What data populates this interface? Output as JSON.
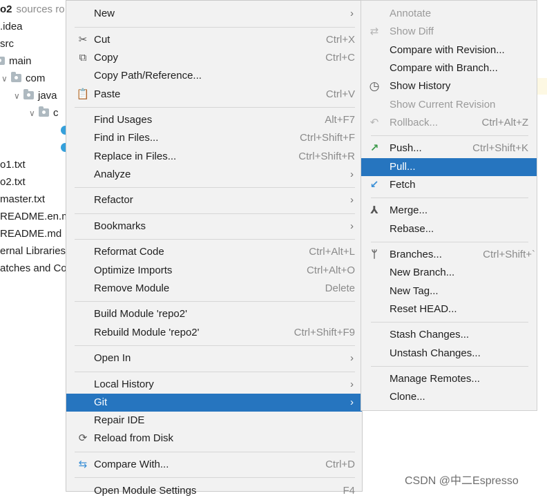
{
  "tree": {
    "project_name": "o2",
    "project_hint": "sources ro",
    "rows": [
      ".idea",
      "src",
      "main",
      "com",
      "java",
      "c",
      "o1.txt",
      "o2.txt",
      "master.txt",
      "README.en.m",
      "README.md",
      "ernal Libraries",
      "atches and Co"
    ]
  },
  "menu": {
    "items": [
      {
        "label": "New",
        "shortcut": "",
        "icon": ""
      },
      {
        "label": "Cut",
        "shortcut": "Ctrl+X",
        "icon": "scissors-icon"
      },
      {
        "label": "Copy",
        "shortcut": "Ctrl+C",
        "icon": "copy-icon"
      },
      {
        "label": "Copy Path/Reference...",
        "shortcut": "",
        "icon": ""
      },
      {
        "label": "Paste",
        "shortcut": "Ctrl+V",
        "icon": "paste-icon"
      },
      {
        "label": "Find Usages",
        "shortcut": "Alt+F7",
        "icon": ""
      },
      {
        "label": "Find in Files...",
        "shortcut": "Ctrl+Shift+F",
        "icon": ""
      },
      {
        "label": "Replace in Files...",
        "shortcut": "Ctrl+Shift+R",
        "icon": ""
      },
      {
        "label": "Analyze",
        "shortcut": "",
        "icon": ""
      },
      {
        "label": "Refactor",
        "shortcut": "",
        "icon": ""
      },
      {
        "label": "Bookmarks",
        "shortcut": "",
        "icon": ""
      },
      {
        "label": "Reformat Code",
        "shortcut": "Ctrl+Alt+L",
        "icon": ""
      },
      {
        "label": "Optimize Imports",
        "shortcut": "Ctrl+Alt+O",
        "icon": ""
      },
      {
        "label": "Remove Module",
        "shortcut": "Delete",
        "icon": ""
      },
      {
        "label": "Build Module 'repo2'",
        "shortcut": "",
        "icon": ""
      },
      {
        "label": "Rebuild Module 'repo2'",
        "shortcut": "Ctrl+Shift+F9",
        "icon": ""
      },
      {
        "label": "Open In",
        "shortcut": "",
        "icon": ""
      },
      {
        "label": "Local History",
        "shortcut": "",
        "icon": ""
      },
      {
        "label": "Git",
        "shortcut": "",
        "icon": ""
      },
      {
        "label": "Repair IDE",
        "shortcut": "",
        "icon": ""
      },
      {
        "label": "Reload from Disk",
        "shortcut": "",
        "icon": "reload-icon"
      },
      {
        "label": "Compare With...",
        "shortcut": "Ctrl+D",
        "icon": "compare-icon"
      },
      {
        "label": "Open Module Settings",
        "shortcut": "F4",
        "icon": ""
      }
    ]
  },
  "git_menu": {
    "items": [
      {
        "label": "Annotate",
        "shortcut": "",
        "icon": ""
      },
      {
        "label": "Show Diff",
        "shortcut": "",
        "icon": "diff-icon"
      },
      {
        "label": "Compare with Revision...",
        "shortcut": "",
        "icon": ""
      },
      {
        "label": "Compare with Branch...",
        "shortcut": "",
        "icon": ""
      },
      {
        "label": "Show History",
        "shortcut": "",
        "icon": "clock-icon"
      },
      {
        "label": "Show Current Revision",
        "shortcut": "",
        "icon": ""
      },
      {
        "label": "Rollback...",
        "shortcut": "Ctrl+Alt+Z",
        "icon": "rollback-icon"
      },
      {
        "label": "Push...",
        "shortcut": "Ctrl+Shift+K",
        "icon": "push-arrow-icon"
      },
      {
        "label": "Pull...",
        "shortcut": "",
        "icon": ""
      },
      {
        "label": "Fetch",
        "shortcut": "",
        "icon": "fetch-arrow-icon"
      },
      {
        "label": "Merge...",
        "shortcut": "",
        "icon": "merge-icon"
      },
      {
        "label": "Rebase...",
        "shortcut": "",
        "icon": ""
      },
      {
        "label": "Branches...",
        "shortcut": "Ctrl+Shift+`",
        "icon": "branch-icon"
      },
      {
        "label": "New Branch...",
        "shortcut": "",
        "icon": ""
      },
      {
        "label": "New Tag...",
        "shortcut": "",
        "icon": ""
      },
      {
        "label": "Reset HEAD...",
        "shortcut": "",
        "icon": ""
      },
      {
        "label": "Stash Changes...",
        "shortcut": "",
        "icon": ""
      },
      {
        "label": "Unstash Changes...",
        "shortcut": "",
        "icon": ""
      },
      {
        "label": "Manage Remotes...",
        "shortcut": "",
        "icon": ""
      },
      {
        "label": "Clone...",
        "shortcut": "",
        "icon": ""
      }
    ]
  },
  "watermark": "CSDN @中二Espresso",
  "colors": {
    "selection": "#2675bf",
    "menu_bg": "#f2f2f2",
    "push_green": "#3c9a4a",
    "fetch_blue": "#3a8fd6"
  }
}
